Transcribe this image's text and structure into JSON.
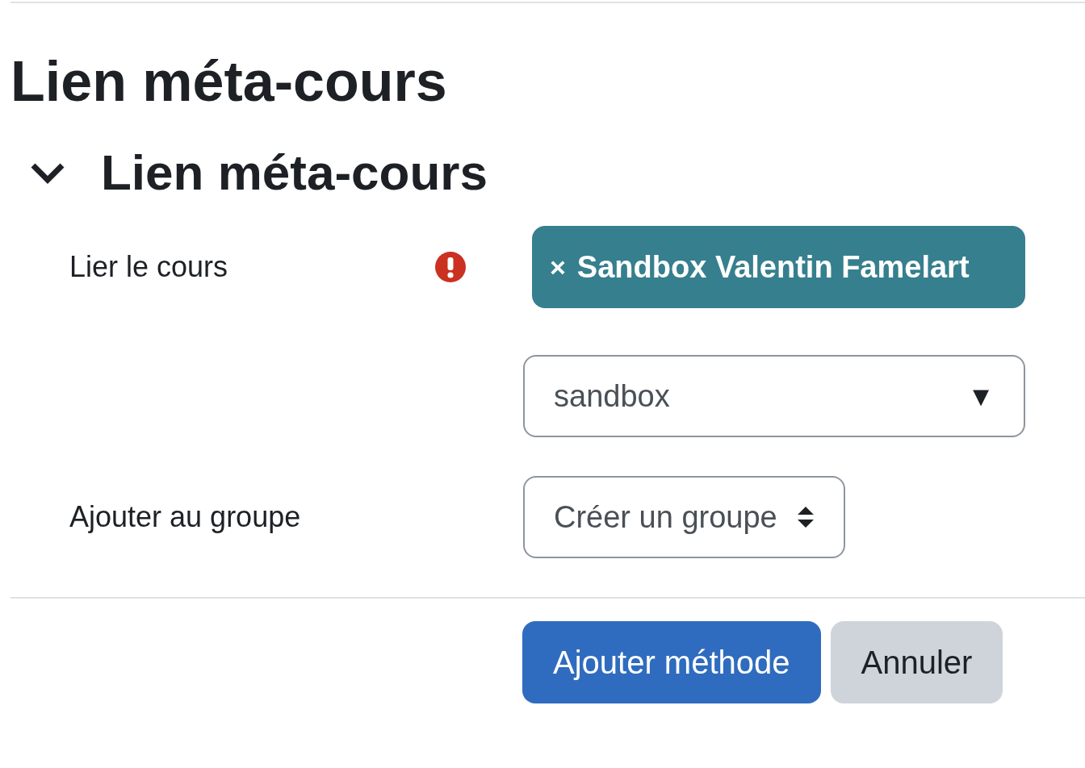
{
  "page_title": "Lien méta-cours",
  "section": {
    "title": "Lien méta-cours",
    "expanded": true
  },
  "fields": [
    {
      "kind": "autocomplete",
      "label": "Lier le cours",
      "required": true,
      "chips": [
        {
          "remove": "×",
          "text": "Sandbox Valentin Famelart"
        }
      ],
      "value": "sandbox",
      "caret": "▼"
    },
    {
      "kind": "select",
      "label": "Ajouter au groupe",
      "required": false,
      "value": "Créer un groupe"
    }
  ],
  "buttons": [
    {
      "label": "Ajouter méthode",
      "kind": "primary"
    },
    {
      "label": "Annuler",
      "kind": "secondary"
    }
  ]
}
